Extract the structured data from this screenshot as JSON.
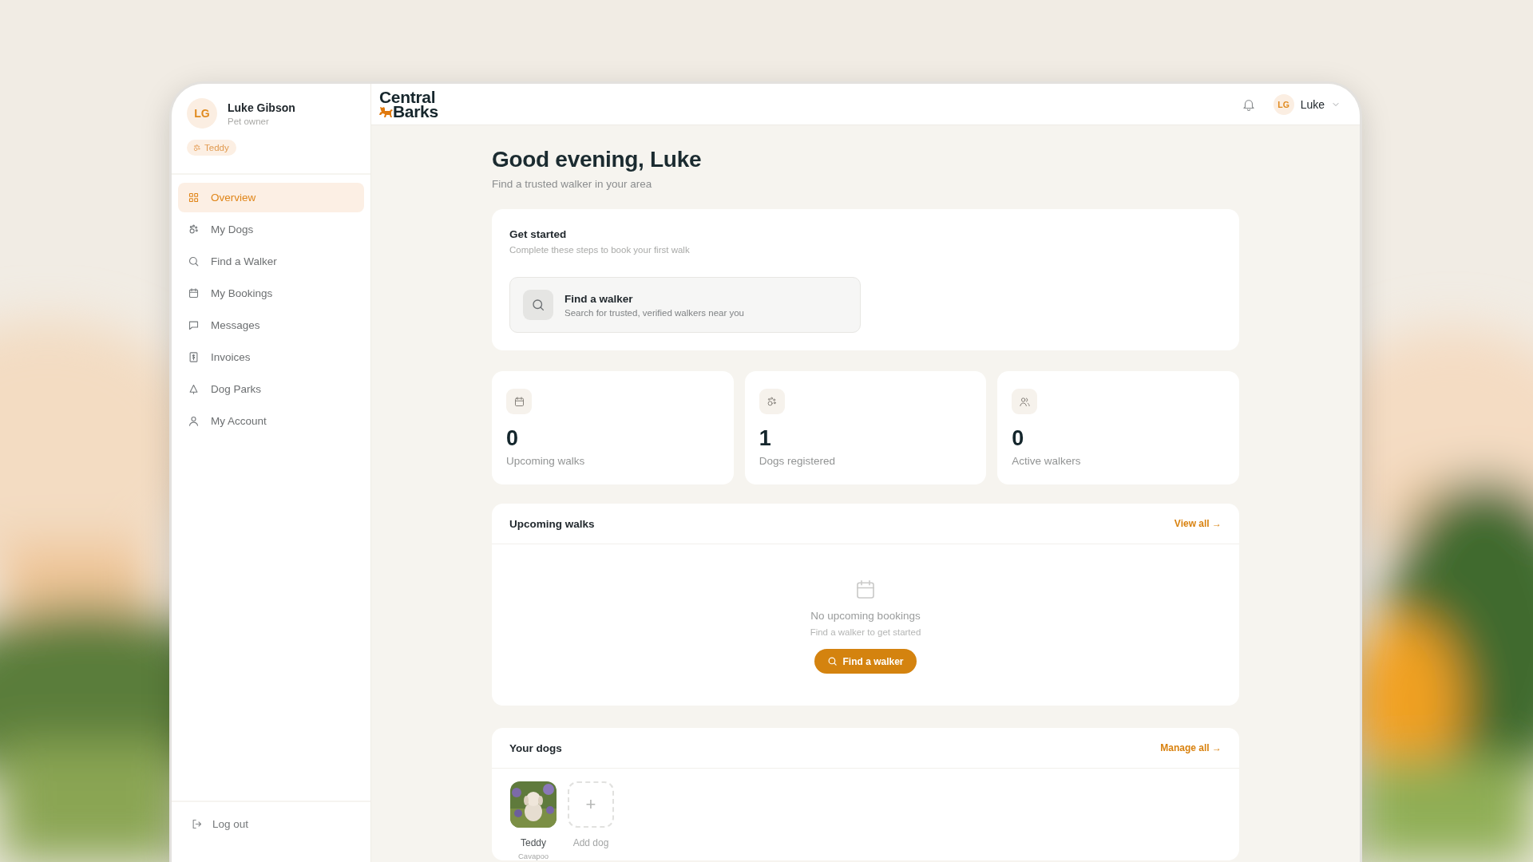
{
  "sidebar": {
    "user": {
      "initials": "LG",
      "name": "Luke Gibson",
      "role": "Pet owner"
    },
    "dog_chip": "Teddy",
    "nav": [
      {
        "label": "Overview",
        "kind": "grid",
        "selected": true
      },
      {
        "label": "My Dogs",
        "kind": "paw",
        "selected": false
      },
      {
        "label": "Find a Walker",
        "kind": "search",
        "selected": false
      },
      {
        "label": "My Bookings",
        "kind": "calendar",
        "selected": false
      },
      {
        "label": "Messages",
        "kind": "message",
        "selected": false
      },
      {
        "label": "Invoices",
        "kind": "invoice",
        "selected": false
      },
      {
        "label": "Dog Parks",
        "kind": "tree",
        "selected": false
      },
      {
        "label": "My Account",
        "kind": "user",
        "selected": false
      }
    ],
    "logout": "Log out"
  },
  "header": {
    "logo": [
      "Central",
      "Barks"
    ],
    "user": {
      "initials": "LG",
      "name": "Luke"
    }
  },
  "greeting": {
    "title": "Good evening, Luke",
    "subtitle": "Find a trusted walker in your area"
  },
  "get_started": {
    "title": "Get started",
    "subtitle": "Complete these steps to book your first walk",
    "steps": [
      {
        "title": "Find a walker",
        "description": "Search for trusted, verified walkers near you"
      }
    ]
  },
  "stats": [
    {
      "kind": "calendar",
      "value": "0",
      "label": "Upcoming walks"
    },
    {
      "kind": "paw",
      "value": "1",
      "label": "Dogs registered"
    },
    {
      "kind": "users",
      "value": "0",
      "label": "Active walkers"
    }
  ],
  "upcoming_walks": {
    "title": "Upcoming walks",
    "link": "View all →",
    "empty_title": "No upcoming bookings",
    "empty_hint": "Find a walker to get started",
    "button": "Find a walker"
  },
  "your_dogs": {
    "title": "Your dogs",
    "link": "Manage all →",
    "dogs": [
      {
        "name": "Teddy",
        "breed": "Cavapoo",
        "kind": "picture"
      }
    ],
    "add_label": "Add dog",
    "add_symbol": "+"
  }
}
